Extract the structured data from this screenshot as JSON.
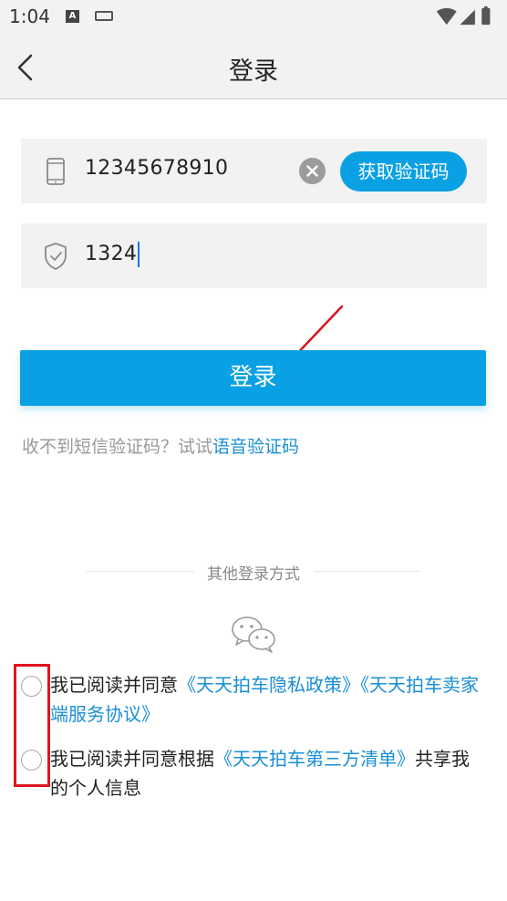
{
  "status_bar": {
    "time": "1:04",
    "notification_icons": [
      "a-icon",
      "keyboard-icon"
    ],
    "right_icons": [
      "wifi-icon",
      "signal-icon",
      "battery-icon"
    ]
  },
  "header": {
    "title": "登录",
    "back_icon": "chevron-left-icon"
  },
  "phone_field": {
    "icon": "phone-icon",
    "value": "12345678910",
    "clear_icon": "clear-icon",
    "get_code_label": "获取验证码"
  },
  "code_field": {
    "icon": "shield-check-icon",
    "value": "1324"
  },
  "login_button": {
    "label": "登录"
  },
  "hint": {
    "prefix": "收不到短信验证码？试试",
    "link": "语音验证码"
  },
  "other_login": {
    "title": "其他登录方式",
    "wechat_icon": "wechat-icon"
  },
  "agreements": [
    {
      "prefix": "我已阅读并同意",
      "link1": "《天天拍车隐私政策》",
      "link2": "《天天拍车卖家端服务协议》",
      "suffix": ""
    },
    {
      "prefix": "我已阅读并同意根据",
      "link1": "《天天拍车第三方清单》",
      "suffix": "共享我的个人信息"
    }
  ],
  "colors": {
    "accent": "#0aa1e4",
    "link": "#1a8fd6",
    "annotation_red": "#e0141e",
    "annotation_arrow": "#d9141c",
    "field_bg": "#f2f2f2",
    "hint_gray": "#999999"
  }
}
